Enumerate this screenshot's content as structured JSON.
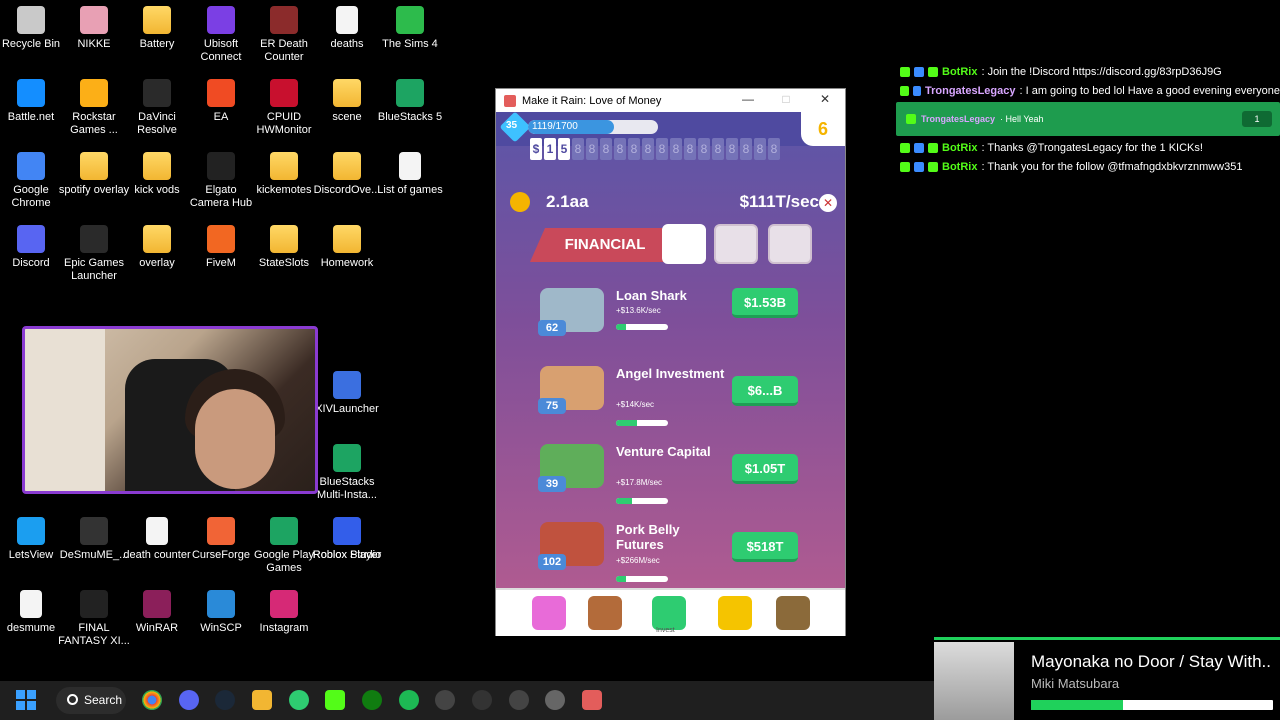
{
  "desktop": {
    "icons": [
      {
        "label": "Recycle Bin",
        "icon": "recycle-bin-icon"
      },
      {
        "label": "NIKKE",
        "icon": "nikke-icon"
      },
      {
        "label": "Battery",
        "icon": "folder-icon"
      },
      {
        "label": "Ubisoft Connect",
        "icon": "ubisoft-icon"
      },
      {
        "label": "ER Death Counter",
        "icon": "er-death-counter-icon"
      },
      {
        "label": "deaths",
        "icon": "document-icon"
      },
      {
        "label": "The Sims 4",
        "icon": "sims-icon"
      },
      {
        "label": "Battle.net",
        "icon": "battlenet-icon"
      },
      {
        "label": "Rockstar Games ...",
        "icon": "rockstar-icon"
      },
      {
        "label": "DaVinci Resolve",
        "icon": "davinci-icon"
      },
      {
        "label": "EA",
        "icon": "ea-icon"
      },
      {
        "label": "CPUID HWMonitor",
        "icon": "hwmonitor-icon"
      },
      {
        "label": "scene",
        "icon": "folder-icon"
      },
      {
        "label": "BlueStacks 5",
        "icon": "bluestacks-icon"
      },
      {
        "label": "Google Chrome",
        "icon": "chrome-icon"
      },
      {
        "label": "spotify overlay",
        "icon": "folder-icon"
      },
      {
        "label": "kick vods",
        "icon": "folder-icon"
      },
      {
        "label": "Elgato Camera Hub",
        "icon": "elgato-icon"
      },
      {
        "label": "kickemotes",
        "icon": "folder-icon"
      },
      {
        "label": "DiscordOve...",
        "icon": "folder-icon"
      },
      {
        "label": "List of games",
        "icon": "document-icon"
      },
      {
        "label": "Discord",
        "icon": "discord-icon"
      },
      {
        "label": "Epic Games Launcher",
        "icon": "epic-icon"
      },
      {
        "label": "overlay",
        "icon": "folder-icon"
      },
      {
        "label": "FiveM",
        "icon": "fivem-icon"
      },
      {
        "label": "StateSlots",
        "icon": "folder-icon"
      },
      {
        "label": "Homework",
        "icon": "folder-icon"
      },
      {
        "label": "XIVLauncher",
        "icon": "xivlauncher-icon"
      },
      {
        "label": "BlueStacks Multi-Insta...",
        "icon": "bluestacks-multi-icon"
      },
      {
        "label": "Roblox Studio",
        "icon": "roblox-studio-icon"
      },
      {
        "label": "LetsView",
        "icon": "letsview-icon"
      },
      {
        "label": "DeSmuME_...",
        "icon": "desmume-icon"
      },
      {
        "label": "death counter",
        "icon": "document-icon"
      },
      {
        "label": "CurseForge",
        "icon": "curseforge-icon"
      },
      {
        "label": "Google Play Games",
        "icon": "google-play-games-icon"
      },
      {
        "label": "Roblox Player",
        "icon": "roblox-player-icon"
      },
      {
        "label": "desmume",
        "icon": "document-icon"
      },
      {
        "label": "FINAL FANTASY XI...",
        "icon": "ffxiv-icon"
      },
      {
        "label": "WinRAR",
        "icon": "winrar-icon"
      },
      {
        "label": "WinSCP",
        "icon": "winscp-icon"
      },
      {
        "label": "Instagram",
        "icon": "instagram-icon"
      }
    ]
  },
  "game_window": {
    "title": "Make it Rain: Love of Money",
    "level": "35",
    "xp_text": "1119/1700",
    "xp_fraction": 0.66,
    "coins": "6",
    "digit_display": [
      "$",
      "1",
      "5",
      "8",
      "8",
      "8",
      "8",
      "8",
      "8",
      "8",
      "8",
      "8",
      "8",
      "8",
      "8",
      "8",
      "8",
      "8"
    ],
    "cash": "2.1aa",
    "rate": "$111T/sec",
    "category": "FINANCIAL",
    "investments": [
      {
        "name": "Loan Shark",
        "rate": "+$13.6K/sec",
        "level": "62",
        "cost": "$1.53B",
        "progress": 0.2
      },
      {
        "name": "Angel Investment",
        "rate": "+$14K/sec",
        "level": "75",
        "cost": "$6...B",
        "progress": 0.4
      },
      {
        "name": "Venture Capital",
        "rate": "+$17.8M/sec",
        "level": "39",
        "cost": "$1.05T",
        "progress": 0.3
      },
      {
        "name": "Pork Belly Futures",
        "rate": "+$266M/sec",
        "level": "102",
        "cost": "$518T",
        "progress": 0.2
      }
    ],
    "nav_label": "Invest"
  },
  "chat": {
    "messages": [
      {
        "user": "BotRix",
        "text": ": Join the !Discord https://discord.gg/83rpD36J9G"
      },
      {
        "user": "TrongatesLegacy",
        "text": ": I am going to bed lol Have a good evening everyone"
      },
      {
        "user": "TrongatesLegacy",
        "text": "· Hell Yeah",
        "highlight": true,
        "pill": "1"
      },
      {
        "user": "BotRix",
        "text": ": Thanks @TrongatesLegacy for the 1 KICKs!"
      },
      {
        "user": "BotRix",
        "text": ": Thank you for the follow @tfmafngdxbkvrznmww351"
      }
    ]
  },
  "now_playing": {
    "title": "Mayonaka no Door / Stay With...",
    "artist": "Miki Matsubara",
    "progress": 0.38
  },
  "taskbar": {
    "search_label": "Search"
  }
}
